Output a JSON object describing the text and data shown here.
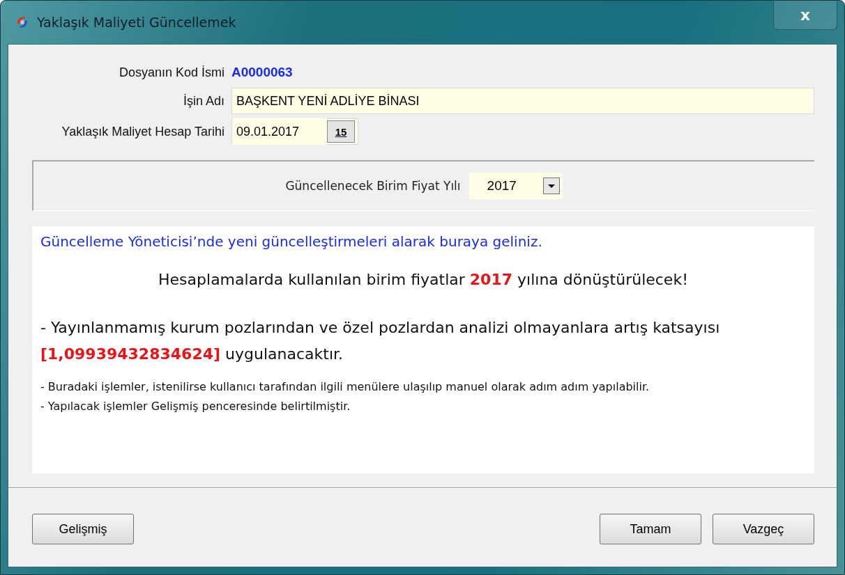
{
  "window": {
    "title": "Yaklaşık Maliyeti Güncellemek",
    "close": "x"
  },
  "form": {
    "code_label": "Dosyanın Kod İsmi",
    "code_value": "A0000063",
    "name_label": "İşin Adı",
    "name_value": "BAŞKENT YENİ ADLİYE BİNASI",
    "date_label": "Yaklaşık Maliyet Hesap Tarihi",
    "date_value": "09.01.2017",
    "calendar_button": "15"
  },
  "year_panel": {
    "label": "Güncellenecek Birim Fiyat Yılı",
    "value": "2017"
  },
  "messages": [
    {
      "kind": "hint",
      "text": "Güncelleme Yöneticisi’nde yeni güncelleştirmeleri alarak buraya geliniz."
    },
    {
      "kind": "headline",
      "text": "Hesaplamalarda kullanılan birim fiyatlar **2017** yılına dönüştürülecek!"
    },
    {
      "kind": "warning",
      "text": " - Yayınlanmamış kurum pozlarından ve özel pozlardan analizi olmayanlara artış katsayısı **[1,09939432834624]** uygulanacaktır."
    },
    {
      "kind": "note",
      "text": " - Buradaki işlemler, istenilirse kullanıcı tarafından ilgili menülere ulaşılıp manuel olarak adım adım yapılabilir."
    },
    {
      "kind": "note",
      "text": " - Yapılacak işlemler Gelişmiş penceresinde belirtilmiştir."
    }
  ],
  "buttons": {
    "advanced": "Gelişmiş",
    "ok": "Tamam",
    "cancel": "Vazgeç"
  }
}
